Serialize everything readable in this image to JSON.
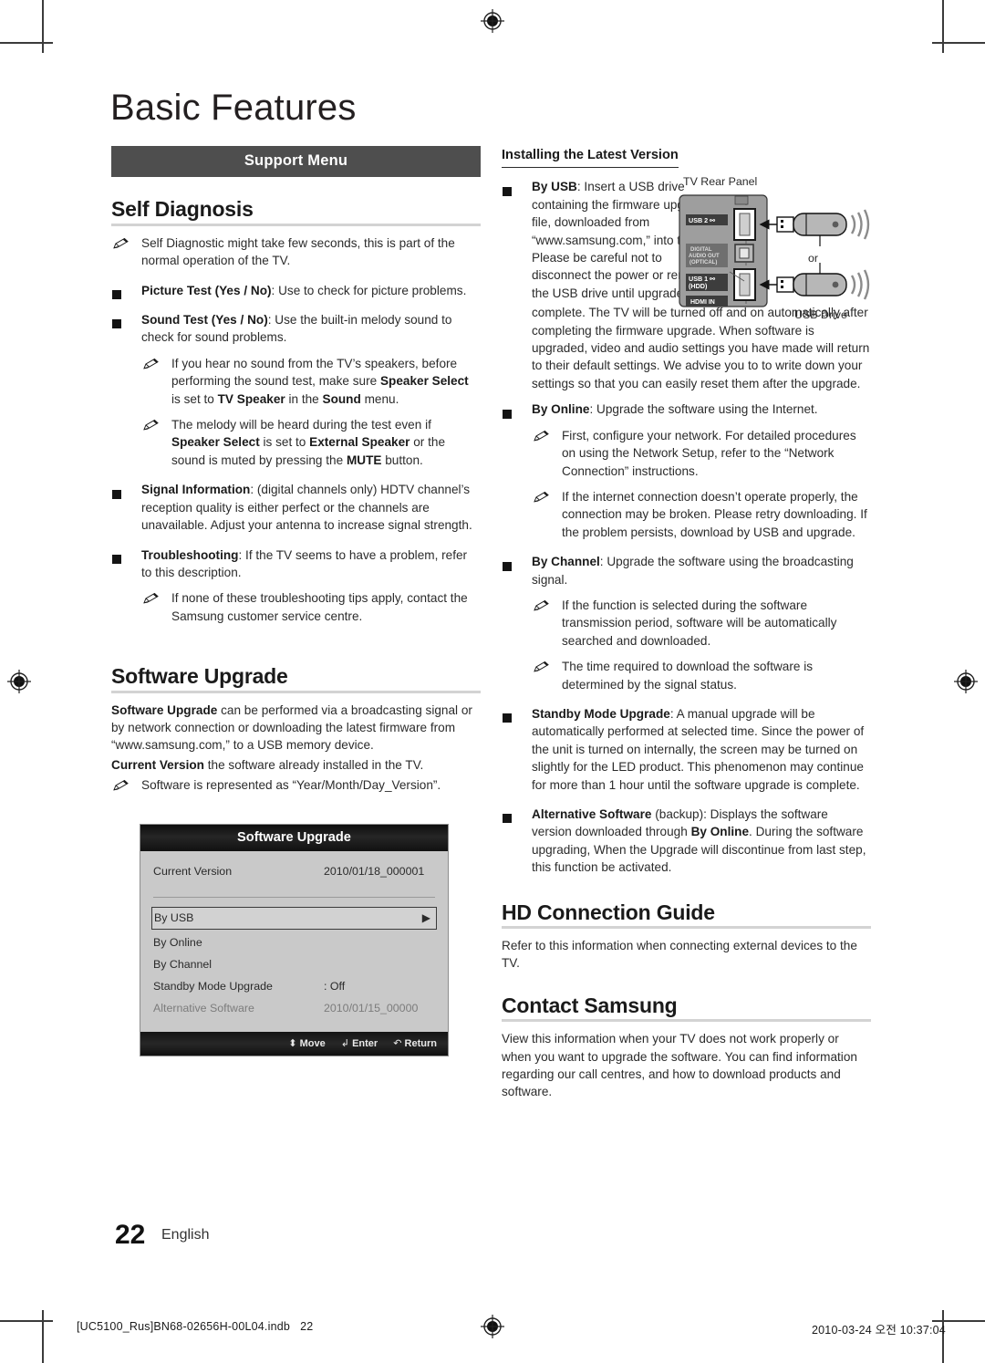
{
  "page": {
    "doc_title": "Basic Features",
    "page_number": "22",
    "language": "English"
  },
  "footer": {
    "file_name": "[UC5100_Rus]BN68-02656H-00L04.indb",
    "file_page": "22",
    "timestamp": "2010-03-24   오전 10:37:04"
  },
  "left_column": {
    "band_label": "Support Menu",
    "self_diagnosis": {
      "heading": "Self Diagnosis",
      "note_1": "Self Diagnostic might take few seconds, this is part of the normal operation of the TV.",
      "picture_test_bold": "Picture Test (Yes / No)",
      "picture_test_rest": ": Use to check for picture problems.",
      "sound_test_bold": "Sound Test (Yes / No)",
      "sound_test_rest": ": Use the built-in melody sound to check for sound problems.",
      "sound_note_1_a": "If you hear no sound from the TV’s speakers, before performing the sound test, make sure ",
      "sound_note_1_b1": "Speaker Select",
      "sound_note_1_c": " is set to ",
      "sound_note_1_b2": "TV Speaker",
      "sound_note_1_d": " in the ",
      "sound_note_1_b3": "Sound",
      "sound_note_1_e": " menu.",
      "sound_note_2_a": "The melody will be heard during the test even if ",
      "sound_note_2_b1": "Speaker Select",
      "sound_note_2_c": " is set to ",
      "sound_note_2_b2": "External Speaker",
      "sound_note_2_d": " or the sound is muted by pressing the ",
      "sound_note_2_b3": "MUTE",
      "sound_note_2_e": " button.",
      "signal_info_bold": "Signal Information",
      "signal_info_rest": ": (digital channels only) HDTV channel’s reception quality is either perfect or the channels are unavailable. Adjust your antenna to increase signal strength.",
      "troubleshooting_bold": "Troubleshooting",
      "troubleshooting_rest": ": If the TV seems to have a problem, refer to this description.",
      "troubleshooting_note": "If none of these troubleshooting tips apply, contact the Samsung customer service centre."
    },
    "software_upgrade": {
      "heading": "Software Upgrade",
      "para_1_bold": "Software Upgrade",
      "para_1_rest": " can be performed via a broadcasting signal or by network connection or downloading the latest firmware from “www.samsung.com,” to a USB memory device.",
      "para_2_bold": "Current Version",
      "para_2_rest": " the software already installed in the TV.",
      "note_1": "Software is represented as “Year/Month/Day_Version”."
    },
    "osd": {
      "title": "Software Upgrade",
      "current_version_label": "Current Version",
      "current_version_value": "2010/01/18_000001",
      "rows": [
        {
          "label": "By USB",
          "value": "",
          "selected": true,
          "arrow": "▶",
          "dim": false
        },
        {
          "label": "By Online",
          "value": "",
          "selected": false,
          "arrow": "",
          "dim": false
        },
        {
          "label": "By Channel",
          "value": "",
          "selected": false,
          "arrow": "",
          "dim": false
        },
        {
          "label": "Standby Mode Upgrade",
          "value": ": Off",
          "selected": false,
          "arrow": "",
          "dim": false
        },
        {
          "label": "Alternative Software",
          "value": "2010/01/15_00000",
          "selected": false,
          "arrow": "",
          "dim": true
        }
      ],
      "hints": [
        {
          "glyph": "⬍",
          "label": "Move"
        },
        {
          "glyph": "↲",
          "label": "Enter"
        },
        {
          "glyph": "↶",
          "label": "Return"
        }
      ]
    }
  },
  "right_column": {
    "installing": {
      "heading": "Installing the Latest Version",
      "by_usb_bold": "By USB",
      "by_usb_rest_narrow": ": Insert a USB drive containing the firmware upgrade file, downloaded from “www.samsung.com,” into the TV. Please be careful not to disconnect the power or remove the USB drive until upgrades are",
      "by_usb_rest_wide": "complete. The TV will be turned off and on automatically after completing the firmware upgrade. When software is upgraded, video and audio settings you have made will return to their default settings. We advise you to to write down your settings so that you can easily reset them after the upgrade.",
      "by_online_bold": "By Online",
      "by_online_rest": ": Upgrade the software using the Internet.",
      "by_online_note_1": "First, configure your network. For detailed procedures on using the Network Setup, refer to the “Network Connection” instructions.",
      "by_online_note_2": "If the internet connection doesn’t operate properly, the connection may be broken. Please retry downloading. If the problem persists, download by USB and upgrade.",
      "by_channel_bold": "By Channel",
      "by_channel_rest": ": Upgrade the software using the broadcasting signal.",
      "by_channel_note_1": "If the function is selected during the software transmission period, software will be automatically searched and downloaded.",
      "by_channel_note_2": "The time required to download the software is determined by the signal status.",
      "standby_bold": "Standby Mode Upgrade",
      "standby_rest": ": A manual upgrade will be automatically performed at selected time. Since the power of the unit is turned on internally, the screen may be turned on slightly for the LED product. This phenomenon may continue for more than 1 hour until the software upgrade is complete.",
      "alt_sw_bold": "Alternative Software",
      "alt_sw_mid1": " (backup): Displays the software version downloaded through ",
      "alt_sw_bold2": "By Online",
      "alt_sw_rest": ". During the software upgrading, When the Upgrade will discontinue from last step, this function be activated."
    },
    "hd_connection": {
      "heading": "HD Connection Guide",
      "body": "Refer to this information when connecting external devices to the TV."
    },
    "contact_samsung": {
      "heading": "Contact Samsung",
      "body": "View this information when your TV does not work properly or when you want to upgrade the software. You can find information regarding our call centres, and how to download products and software."
    }
  },
  "figure": {
    "caption_panel": "TV Rear Panel",
    "caption_drive": "USB Drive",
    "or_label": "or",
    "ports": [
      {
        "label": "USB 2 ⎇"
      },
      {
        "label": "DIGITAL AUDIO OUT (OPTICAL)"
      },
      {
        "label": "USB 1 ⎇ (HDD)"
      },
      {
        "label": "HDMI IN"
      }
    ],
    "colors": {
      "panel": "#9b9b9b",
      "port_tag": "#4a4a4a",
      "drive_body": "#b4b4b4",
      "outline": "#1a1a1a"
    }
  },
  "colors": {
    "band_bg": "#4e4e4e",
    "rule": "#d3d3d3",
    "text": "#2b2b2b",
    "heading": "#1a1a1a",
    "osd_bg": "#c9c9c9",
    "osd_title_bg": "#141414"
  }
}
